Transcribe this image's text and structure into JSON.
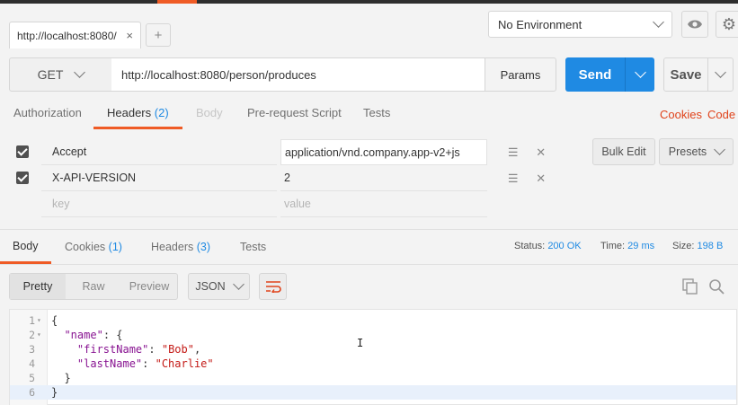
{
  "tabs": {
    "active_tab_label": "http://localhost:8080/",
    "close_glyph": "×",
    "new_tab_glyph": "+"
  },
  "environment": {
    "selected": "No Environment"
  },
  "request": {
    "method": "GET",
    "url": "http://localhost:8080/person/produces",
    "params_label": "Params",
    "send_label": "Send",
    "save_label": "Save"
  },
  "request_tabs": {
    "authorization": "Authorization",
    "headers": "Headers",
    "headers_count": "(2)",
    "body": "Body",
    "prerequest": "Pre-request Script",
    "tests": "Tests",
    "cookies": "Cookies",
    "code": "Code"
  },
  "headers": {
    "rows": [
      {
        "key": "Accept",
        "value": "application/vnd.company.app-v2+js"
      },
      {
        "key": "X-API-VERSION",
        "value": "2"
      }
    ],
    "key_placeholder": "key",
    "value_placeholder": "value",
    "bulk_edit": "Bulk Edit",
    "presets": "Presets"
  },
  "response": {
    "tabs": {
      "body": "Body",
      "cookies": "Cookies",
      "cookies_count": "(1)",
      "headers": "Headers",
      "headers_count": "(3)",
      "tests": "Tests"
    },
    "status_label": "Status:",
    "status_value": "200 OK",
    "time_label": "Time:",
    "time_value": "29 ms",
    "size_label": "Size:",
    "size_value": "198 B",
    "view": {
      "pretty": "Pretty",
      "raw": "Raw",
      "preview": "Preview",
      "format": "JSON"
    },
    "lines": [
      {
        "n": "1",
        "fold": "▾",
        "html": "{"
      },
      {
        "n": "2",
        "fold": "▾",
        "html": "  <span class='k'>\"name\"</span>: {"
      },
      {
        "n": "3",
        "fold": "",
        "html": "    <span class='k'>\"firstName\"</span>: <span class='s'>\"Bob\"</span>,"
      },
      {
        "n": "4",
        "fold": "",
        "html": "    <span class='k'>\"lastName\"</span>: <span class='s'>\"Charlie\"</span>"
      },
      {
        "n": "5",
        "fold": "",
        "html": "  }"
      },
      {
        "n": "6",
        "fold": "",
        "html": "}"
      }
    ]
  },
  "colors": {
    "accent": "#ef5b25",
    "send": "#1f8ae3",
    "link_red": "#e0431b",
    "count_blue": "#1f8ae3"
  },
  "icons": [
    "close-icon",
    "plus-icon",
    "chevron-down-icon",
    "eye-icon",
    "gear-icon",
    "checkbox-checked-icon",
    "drag-handle-icon",
    "delete-icon",
    "wrap-lines-icon",
    "copy-icon",
    "search-icon"
  ]
}
